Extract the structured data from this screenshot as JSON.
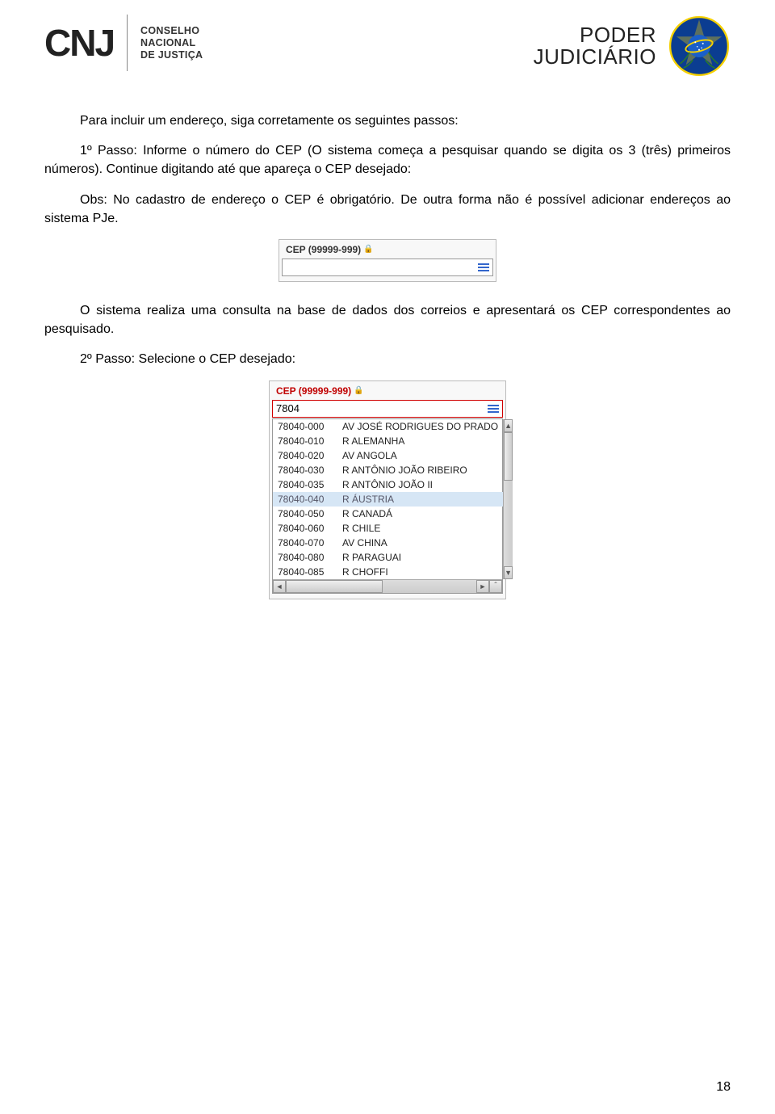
{
  "header": {
    "cnj_logo_text": "CNJ",
    "cnj_sub_line1": "CONSELHO",
    "cnj_sub_line2": "NACIONAL",
    "cnj_sub_line3": "DE JUSTIÇA",
    "poder_line1": "PODER",
    "poder_line2": "JUDICIÁRIO"
  },
  "content": {
    "intro": "Para incluir um endereço, siga corretamente os seguintes passos:",
    "passo1": "1º Passo: Informe o número do CEP (O sistema começa a pesquisar quando se digita os 3 (três) primeiros números). Continue digitando até que apareça o CEP desejado:",
    "obs": "Obs: No cadastro de endereço o CEP é obrigatório. De outra forma não é possível adicionar endereços ao sistema PJe.",
    "middle": "O sistema realiza uma consulta na base de dados dos correios e apresentará os CEP correspondentes ao pesquisado.",
    "passo2": "2º Passo: Selecione o CEP desejado:"
  },
  "field1": {
    "label": "CEP (99999-999)"
  },
  "field2": {
    "label": "CEP (99999-999)",
    "value": "7804",
    "options": [
      {
        "cep": "78040-000",
        "addr": "AV JOSÉ RODRIGUES DO PRADO",
        "selected": false
      },
      {
        "cep": "78040-010",
        "addr": "R ALEMANHA",
        "selected": false
      },
      {
        "cep": "78040-020",
        "addr": "AV ANGOLA",
        "selected": false
      },
      {
        "cep": "78040-030",
        "addr": "R ANTÔNIO JOÃO RIBEIRO",
        "selected": false
      },
      {
        "cep": "78040-035",
        "addr": "R ANTÔNIO JOÃO II",
        "selected": false
      },
      {
        "cep": "78040-040",
        "addr": "R ÁUSTRIA",
        "selected": true
      },
      {
        "cep": "78040-050",
        "addr": "R CANADÁ",
        "selected": false
      },
      {
        "cep": "78040-060",
        "addr": "R CHILE",
        "selected": false
      },
      {
        "cep": "78040-070",
        "addr": "AV CHINA",
        "selected": false
      },
      {
        "cep": "78040-080",
        "addr": "R PARAGUAI",
        "selected": false
      },
      {
        "cep": "78040-085",
        "addr": "R CHOFFI",
        "selected": false
      }
    ]
  },
  "page_number": "18"
}
